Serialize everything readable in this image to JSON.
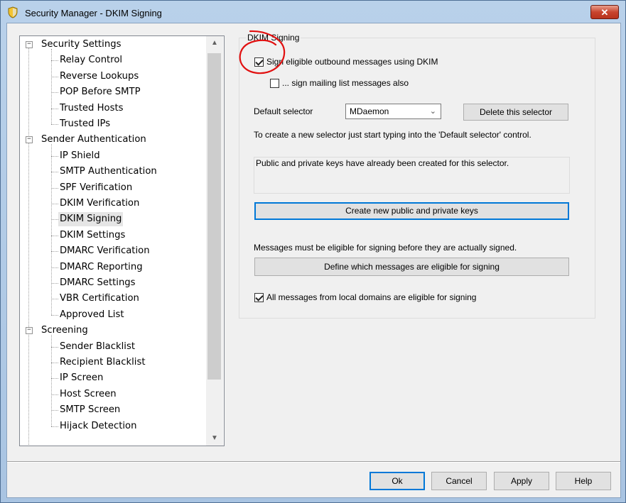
{
  "window": {
    "title": "Security Manager - DKIM Signing",
    "close_glyph": "✕"
  },
  "tree": {
    "groups": [
      {
        "label": "Security Settings",
        "children": [
          "Relay Control",
          "Reverse Lookups",
          "POP Before SMTP",
          "Trusted Hosts",
          "Trusted IPs"
        ]
      },
      {
        "label": "Sender Authentication",
        "children": [
          "IP Shield",
          "SMTP Authentication",
          "SPF Verification",
          "DKIM Verification",
          "DKIM Signing",
          "DKIM Settings",
          "DMARC Verification",
          "DMARC Reporting",
          "DMARC Settings",
          "VBR Certification",
          "Approved List"
        ]
      },
      {
        "label": "Screening",
        "children": [
          "Sender Blacklist",
          "Recipient Blacklist",
          "IP Screen",
          "Host Screen",
          "SMTP Screen",
          "Hijack Detection"
        ]
      }
    ],
    "selected": "DKIM Signing",
    "expander_glyph": "−",
    "scroll_up_glyph": "▲",
    "scroll_down_glyph": "▼"
  },
  "dkim": {
    "group_title": "DKIM Signing",
    "sign_outbound_label": "Sign eligible outbound messages using DKIM",
    "sign_outbound_checked": true,
    "sign_mailing_label": "... sign mailing list messages also",
    "sign_mailing_checked": false,
    "default_selector_label": "Default selector",
    "default_selector_value": "MDaemon",
    "delete_selector_label": "Delete this selector",
    "new_selector_hint": "To create a new selector just start typing into the 'Default selector' control.",
    "keys_status": "Public and private keys have already been created for this selector.",
    "create_keys_label": "Create new public and private keys",
    "eligible_hint": "Messages must be eligible for signing before they are actually signed.",
    "define_eligible_label": "Define which messages are eligible for signing",
    "local_domains_label": "All messages from local domains are eligible for signing",
    "local_domains_checked": true
  },
  "footer": {
    "ok": "Ok",
    "cancel": "Cancel",
    "apply": "Apply",
    "help": "Help"
  },
  "colors": {
    "accent": "#0078d7",
    "annotation": "#e11010",
    "selected_bg": "#e5e5e5"
  }
}
